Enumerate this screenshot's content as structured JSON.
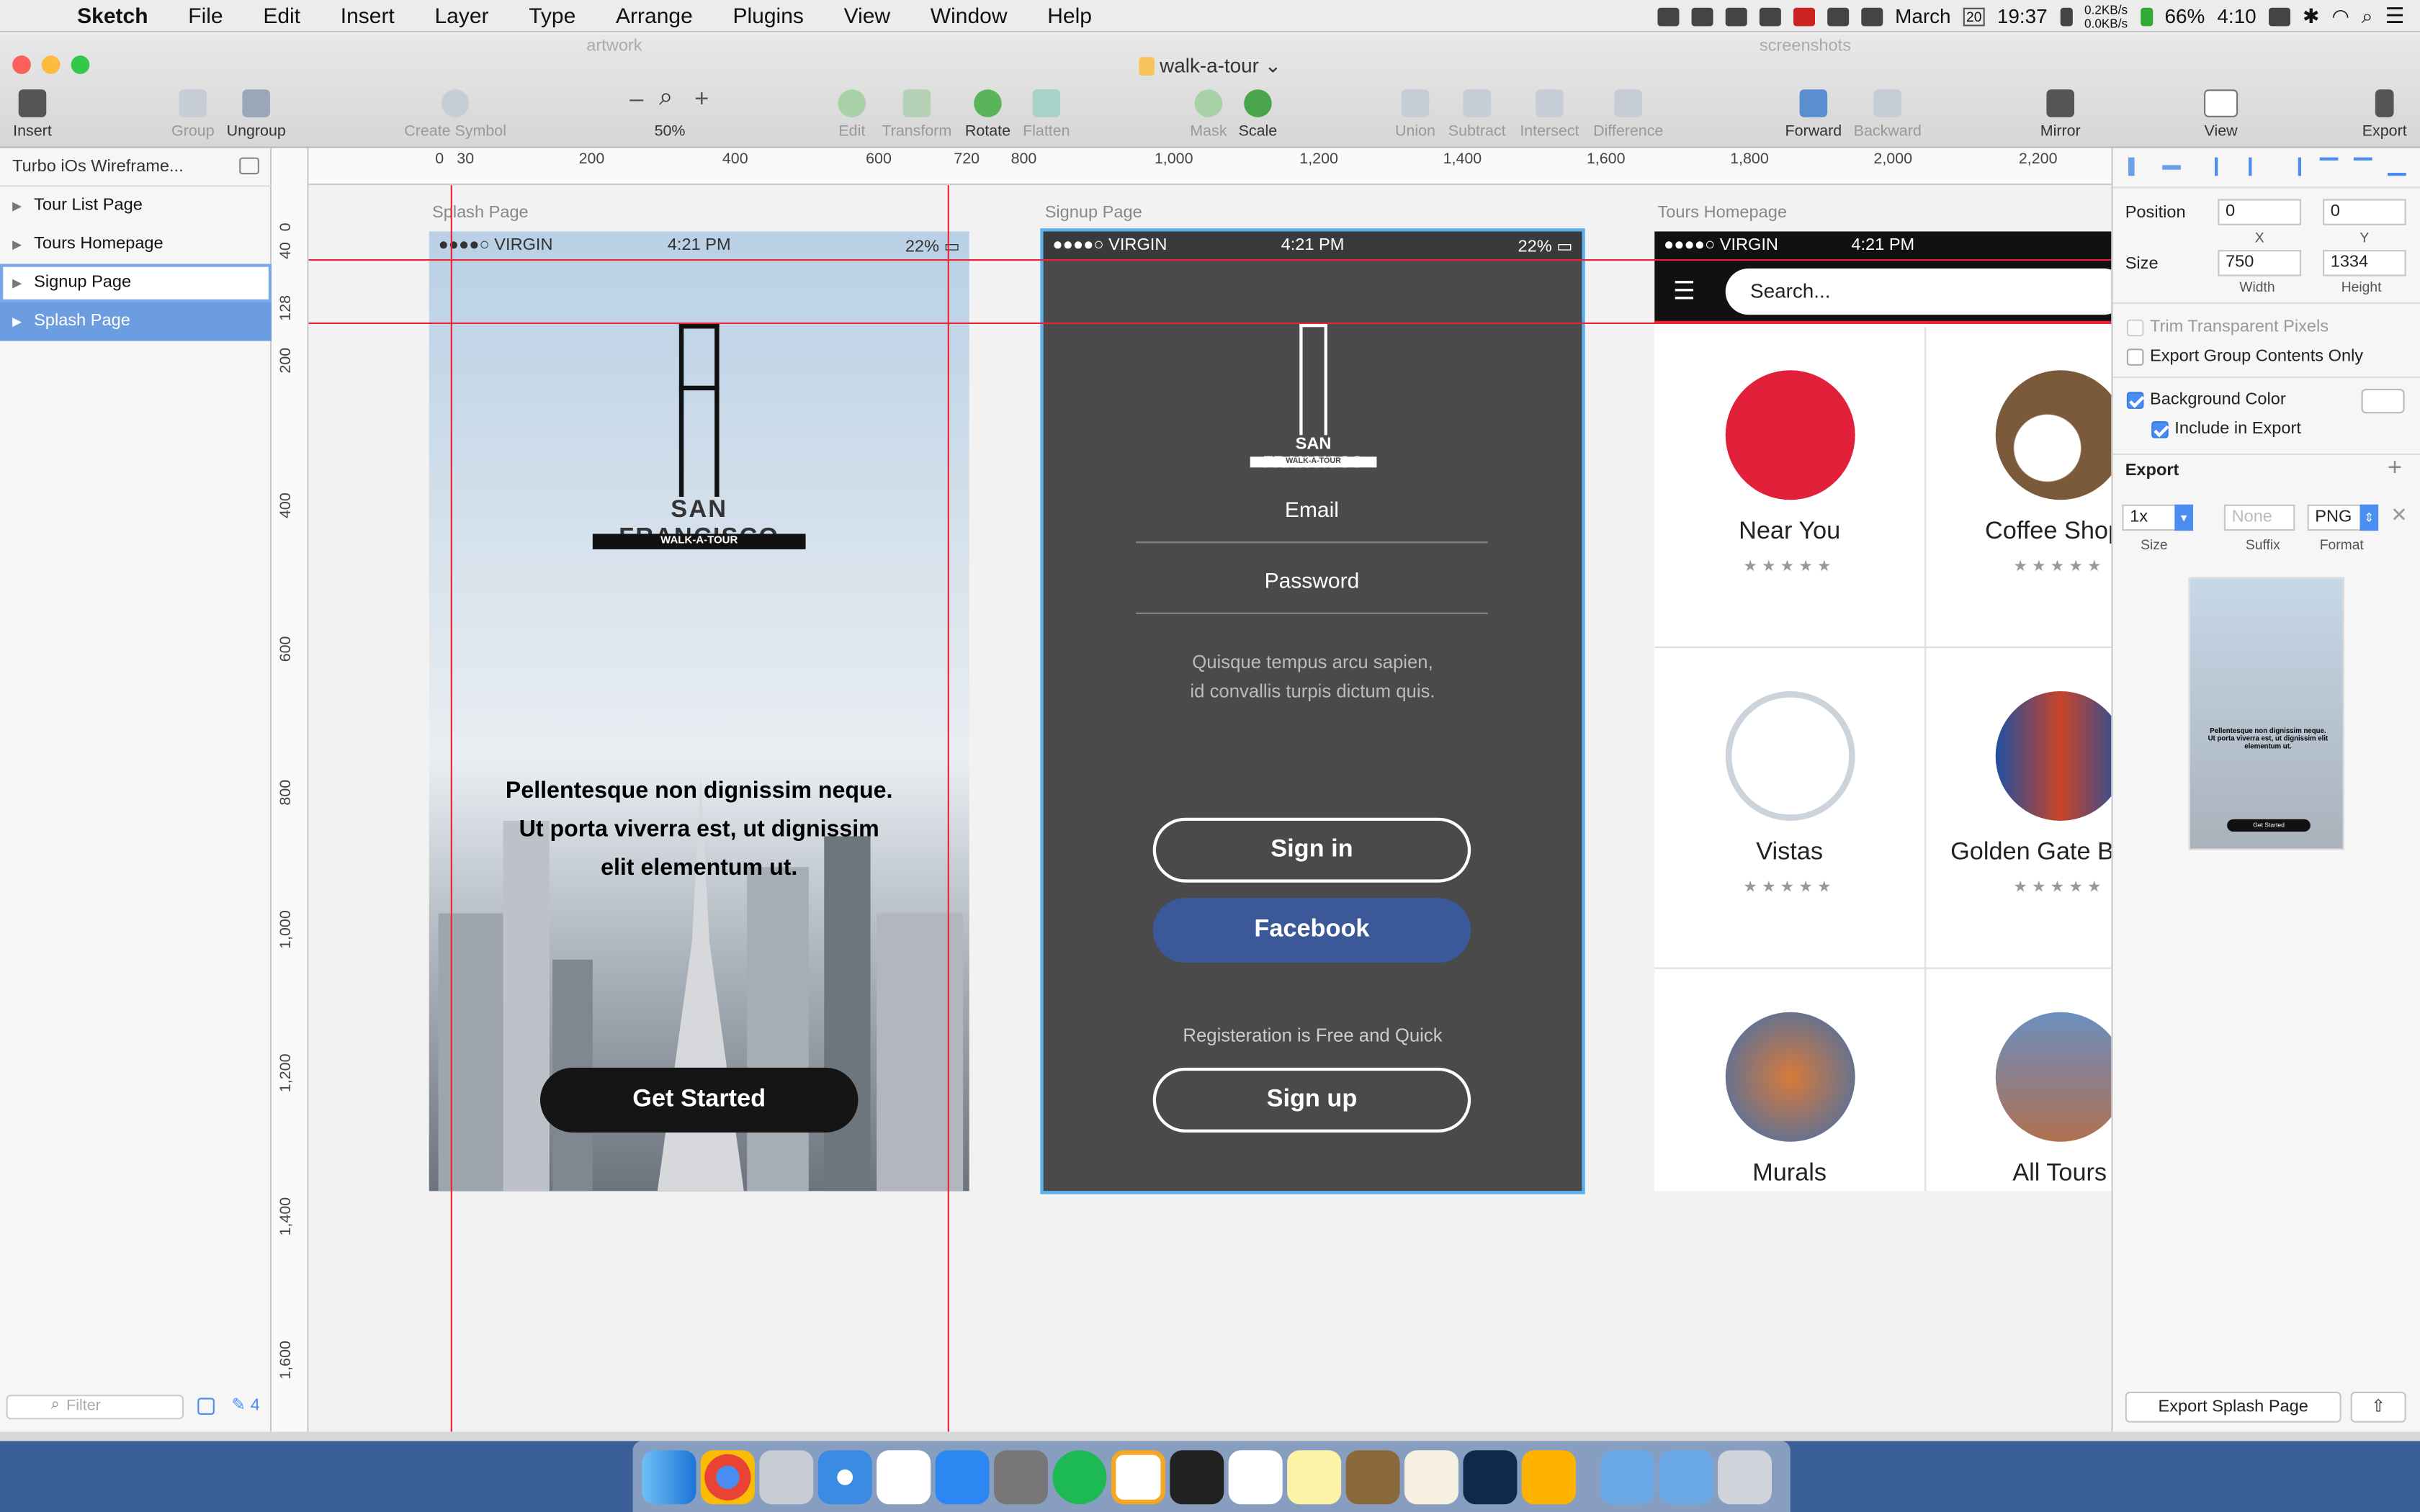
{
  "menubar": {
    "app": "Sketch",
    "items": [
      "File",
      "Edit",
      "Insert",
      "Layer",
      "Type",
      "Arrange",
      "Plugins",
      "View",
      "Window",
      "Help"
    ],
    "date": "March",
    "date_day": "20",
    "time": "19:37",
    "net_up": "0.2KB/s",
    "net_down": "0.0KB/s",
    "battery": "66%",
    "clock": "4:10"
  },
  "window": {
    "title": "walk-a-tour",
    "bg_tab_left": "artwork",
    "bg_tab_right": "screenshots"
  },
  "toolbar": {
    "insert": "Insert",
    "group": "Group",
    "ungroup": "Ungroup",
    "create_symbol": "Create Symbol",
    "zoom_minus": "–",
    "zoom_plus": "+",
    "zoom": "50%",
    "edit": "Edit",
    "transform": "Transform",
    "rotate": "Rotate",
    "flatten": "Flatten",
    "mask": "Mask",
    "scale": "Scale",
    "union": "Union",
    "subtract": "Subtract",
    "intersect": "Intersect",
    "difference": "Difference",
    "forward": "Forward",
    "backward": "Backward",
    "mirror": "Mirror",
    "view": "View",
    "export": "Export"
  },
  "sidebar": {
    "page": "Turbo iOs Wireframe...",
    "layers": [
      "Tour List Page",
      "Tours Homepage",
      "Signup Page",
      "Splash Page"
    ],
    "filter_placeholder": "Filter",
    "count": "4"
  },
  "ruler": {
    "h": [
      "0",
      "30",
      "200",
      "400",
      "600",
      "720",
      "800",
      "1,000",
      "1,200",
      "1,400",
      "1,600",
      "1,800",
      "2,000",
      "2,200"
    ],
    "v": [
      "0",
      "40",
      "128",
      "200",
      "400",
      "600",
      "800",
      "1,000",
      "1,200",
      "1,400",
      "1,600"
    ]
  },
  "artboards": {
    "splash": {
      "label": "Splash Page",
      "carrier": "●●●●○ VIRGIN",
      "time": "4:21 PM",
      "battery": "22%",
      "logo_title": "SAN FRANCISCO",
      "logo_sub": "WALK-A-TOUR",
      "tagline_1": "Pellentesque non dignissim neque.",
      "tagline_2": "Ut porta viverra est, ut dignissim",
      "tagline_3": "elit elementum ut.",
      "cta": "Get Started"
    },
    "signup": {
      "label": "Signup Page",
      "carrier": "●●●●○ VIRGIN",
      "time": "4:21 PM",
      "battery": "22%",
      "logo_title": "SAN FRANCISCO",
      "logo_sub": "WALK-A-TOUR",
      "email": "Email",
      "password": "Password",
      "desc_1": "Quisque tempus arcu sapien,",
      "desc_2": "id convallis turpis dictum quis.",
      "signin": "Sign in",
      "facebook": "Facebook",
      "free": "Registeration is Free and Quick",
      "signup": "Sign up"
    },
    "tours": {
      "label": "Tours Homepage",
      "carrier": "●●●●○ VIRGIN",
      "time": "4:21 PM",
      "search_placeholder": "Search...",
      "categories": [
        {
          "name": "Near You",
          "stars": "★★★★★"
        },
        {
          "name": "Coffee Shops",
          "stars": "★★★★★"
        },
        {
          "name": "Vistas",
          "stars": "★★★★★"
        },
        {
          "name": "Golden Gate Bridge",
          "stars": "★★★★★"
        },
        {
          "name": "Murals",
          "stars": ""
        },
        {
          "name": "All Tours",
          "stars": ""
        }
      ]
    }
  },
  "inspector": {
    "position": "Position",
    "x": "0",
    "y": "0",
    "x_label": "X",
    "y_label": "Y",
    "size": "Size",
    "width": "750",
    "height": "1334",
    "width_label": "Width",
    "height_label": "Height",
    "trim": "Trim Transparent Pixels",
    "export_group": "Export Group Contents Only",
    "bg_color": "Background Color",
    "include": "Include in Export",
    "export": "Export",
    "scale": "1x",
    "suffix_placeholder": "None",
    "format": "PNG",
    "size_label": "Size",
    "suffix_label": "Suffix",
    "format_label": "Format",
    "export_button": "Export Splash Page",
    "preview_text": "Pellentesque non dignissim neque. Ut porta viverra est, ut dignissim elit elementum ut.",
    "preview_cta": "Get Started"
  },
  "colors": {
    "accent": "#4b8ef2",
    "selection": "#6c9de0",
    "guide": "#e22233",
    "signup_bg": "#4a4a4a",
    "facebook": "#3b5998"
  }
}
